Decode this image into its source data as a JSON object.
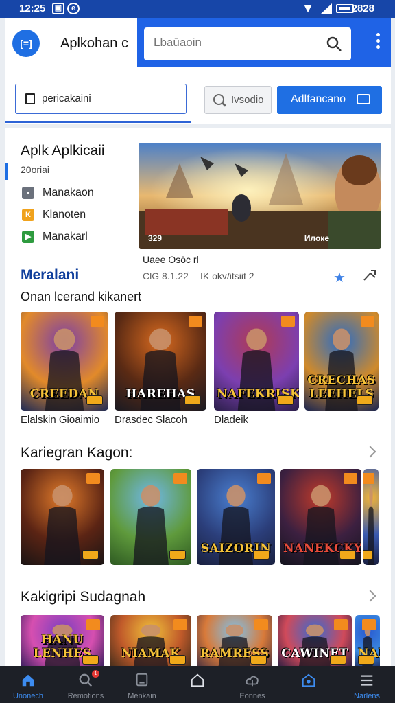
{
  "status_bar": {
    "time": "12:25",
    "icons": [
      "photo-icon",
      "chat-icon"
    ],
    "wifi": "wifi-icon",
    "signal": "signal-icon",
    "battery_level": 0.7,
    "right_text": "2828"
  },
  "header": {
    "logo_text": "[=]",
    "app_title": "Aplkohan c",
    "search": {
      "placeholder": "Lbaūaoin",
      "value": ""
    },
    "menu_icon": "kebab-icon"
  },
  "toolbar": {
    "query": {
      "value": "pericakaini",
      "placeholder": ""
    },
    "secondary_button": "Ivsodio",
    "primary_button": "Adlfancano"
  },
  "featured": {
    "title": "Aplk Aplkicaii",
    "subtitle": "20oriai",
    "nav_items": [
      {
        "label": "Manakaon",
        "color": "#6b717c",
        "icon": "store-icon"
      },
      {
        "label": "Klanoten",
        "color": "#f0a21c",
        "icon": "bookmark-icon"
      },
      {
        "label": "Manakarl",
        "color": "#2e9b3f",
        "icon": "play-icon"
      }
    ],
    "banner": {
      "left_label": "329",
      "right_label": "Илоке",
      "caption_title": "Uaee Osōc rl",
      "caption_meta_1": "ClG 8.1.22",
      "caption_meta_2": "IK okv/itsiit 2"
    }
  },
  "section_1": {
    "title": "Meralani",
    "subtitle": "Onan lcerand kikanert",
    "cards": [
      {
        "logo": "CREEDAN",
        "label": "Elalskin Gioaimio",
        "colors": [
          "#7b3fa8",
          "#e28a2a",
          "#1e2a55"
        ],
        "text_color": "#f5c238"
      },
      {
        "logo": "HAREHAS",
        "label": "Drasdec Slacoh",
        "colors": [
          "#d86a1f",
          "#5a2a14",
          "#1a1a22"
        ],
        "text_color": "#ffffff"
      },
      {
        "logo": "NAFEKRISK",
        "label": "Dladeik",
        "colors": [
          "#b03a54",
          "#7c3fb0",
          "#2b1f4a"
        ],
        "text_color": "#f5c238"
      },
      {
        "logo": "CRECHAS LEEHELS",
        "label": "",
        "colors": [
          "#2b6cc4",
          "#d08a2a",
          "#1c2650"
        ],
        "text_color": "#f5c238"
      }
    ]
  },
  "section_2": {
    "title": "Kariegran Kagon:",
    "cards": [
      {
        "logo": "",
        "colors": [
          "#e07a2a",
          "#5b2414",
          "#1a1414"
        ],
        "text_color": "#ffffff"
      },
      {
        "logo": "",
        "colors": [
          "#6fb7e8",
          "#5f9a3c",
          "#2e5a22"
        ],
        "text_color": "#ffffff"
      },
      {
        "logo": "SAIZORIN",
        "colors": [
          "#4a7fd0",
          "#2b3e7a",
          "#1a2140"
        ],
        "text_color": "#f5c238"
      },
      {
        "logo": "NANEKCKY",
        "colors": [
          "#c03a2a",
          "#3c2040",
          "#14141e"
        ],
        "text_color": "#e84b3a"
      },
      {
        "logo": "",
        "colors": [
          "#f0b43a",
          "#3a5ab0",
          "#1a2040"
        ],
        "text_color": "#ffffff"
      }
    ]
  },
  "section_3": {
    "title": "Kakigripi Sudagnah",
    "cards": [
      {
        "logo": "HANU LENHES",
        "colors": [
          "#7a3fc0",
          "#d64fb0",
          "#2a1a55"
        ],
        "text_color": "#f5c238"
      },
      {
        "logo": "NIAMAK",
        "colors": [
          "#f0c03a",
          "#c05a2a",
          "#3a2a1a"
        ],
        "text_color": "#f5c238"
      },
      {
        "logo": "RAMRESS",
        "colors": [
          "#7fc0e8",
          "#d87a3a",
          "#3a2a40"
        ],
        "text_color": "#f5c238"
      },
      {
        "logo": "CAWINET",
        "colors": [
          "#3a6ad0",
          "#d04a5a",
          "#1a1a40"
        ],
        "text_color": "#ffffff"
      },
      {
        "logo": "NAN",
        "colors": [
          "#2a5ad0",
          "#3a8ae0",
          "#1a2050"
        ],
        "text_color": "#f5c238"
      }
    ]
  },
  "bottom_nav": [
    {
      "label": "Unonech",
      "icon": "home-icon",
      "active": true
    },
    {
      "label": "Remotions",
      "icon": "search-icon",
      "badge": "1"
    },
    {
      "label": "Menkain",
      "icon": "tablet-icon"
    },
    {
      "label": "",
      "icon": "house-outline-icon"
    },
    {
      "label": "Eonnes",
      "icon": "cloud-icon"
    },
    {
      "label": "",
      "icon": "game-icon",
      "active": true
    },
    {
      "label": "Narlens",
      "icon": "menu-icon",
      "active": true
    }
  ],
  "colors": {
    "accent": "#1f6fe3",
    "status_bar": "#1746a8",
    "section_title": "#103f9c",
    "nav_bg": "#1d2027"
  }
}
